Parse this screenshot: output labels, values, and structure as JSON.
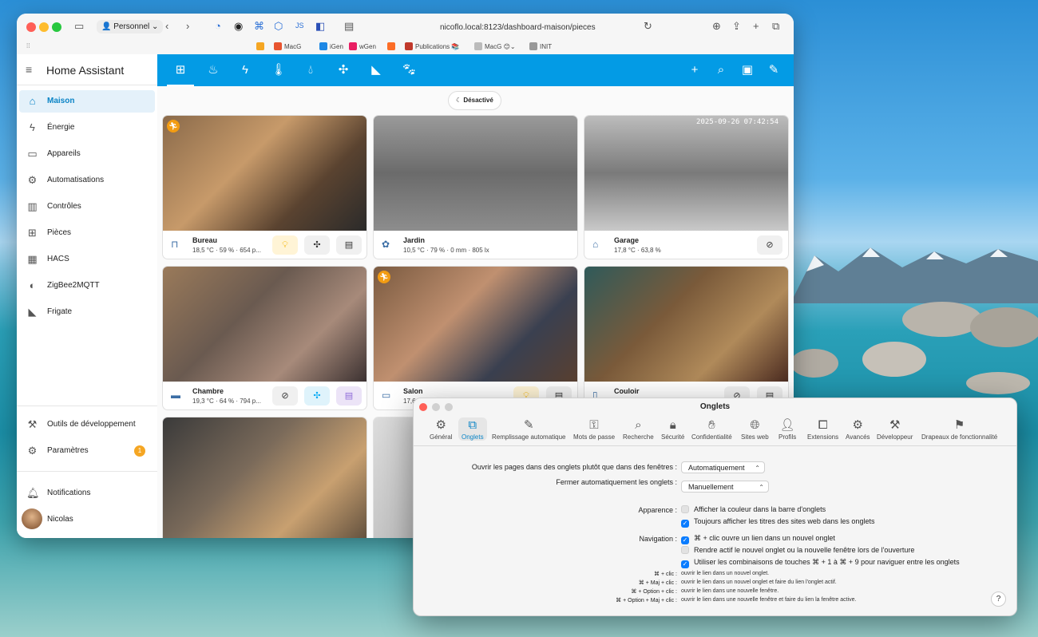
{
  "browser": {
    "profile": "Personnel",
    "url": "nicoflo.local:8123/dashboard-maison/pieces",
    "favorites": [
      "MacG",
      "iGen",
      "wGen",
      "Publications",
      "MacG",
      "INIT"
    ]
  },
  "sidebar": {
    "title": "Home Assistant",
    "items": [
      {
        "label": "Maison",
        "icon": "home-icon"
      },
      {
        "label": "Énergie",
        "icon": "lightning-icon"
      },
      {
        "label": "Appareils",
        "icon": "devices-icon"
      },
      {
        "label": "Automatisations",
        "icon": "robot-icon"
      },
      {
        "label": "Contrôles",
        "icon": "controls-icon"
      },
      {
        "label": "Pièces",
        "icon": "floorplan-icon"
      },
      {
        "label": "HACS",
        "icon": "hacs-icon"
      },
      {
        "label": "ZigBee2MQTT",
        "icon": "zigbee-icon"
      },
      {
        "label": "Frigate",
        "icon": "camera-icon"
      }
    ],
    "dev_tools": "Outils de développement",
    "settings": "Paramètres",
    "settings_badge": "1",
    "notifications": "Notifications",
    "user": "Nicolas"
  },
  "dashboard": {
    "chip": "Désactivé",
    "cameras": [
      {
        "name": "Bureau",
        "info": "18,5 °C · 59 % · 654 p..."
      },
      {
        "name": "Jardin",
        "info": "10,5 °C · 79 % · 0 mm · 805 lx"
      },
      {
        "name": "Garage",
        "info": "17,8 °C · 63,8 %",
        "timestamp": "2025-09-26 07:42:54"
      },
      {
        "name": "Chambre",
        "info": "19,3 °C · 64 % · 794 p..."
      },
      {
        "name": "Salon",
        "info": "17,6"
      },
      {
        "name": "Couloir",
        "info": ""
      }
    ]
  },
  "prefs": {
    "title": "Onglets",
    "tabs": [
      "Général",
      "Onglets",
      "Remplissage automatique",
      "Mots de passe",
      "Recherche",
      "Sécurité",
      "Confidentialité",
      "Sites web",
      "Profils",
      "Extensions",
      "Avancés",
      "Développeur",
      "Drapeaux de fonctionnalité"
    ],
    "open_pages_label": "Ouvrir les pages dans des onglets plutôt que dans des fenêtres :",
    "open_pages_value": "Automatiquement",
    "close_tabs_label": "Fermer automatiquement les onglets :",
    "close_tabs_value": "Manuellement",
    "appearance_label": "Apparence :",
    "appearance_opt1": "Afficher la couleur dans la barre d'onglets",
    "appearance_opt2": "Toujours afficher les titres des sites web dans les onglets",
    "navigation_label": "Navigation :",
    "nav_opt1": "⌘ + clic ouvre un lien dans un nouvel onglet",
    "nav_opt2": "Rendre actif le nouvel onglet ou la nouvelle fenêtre lors de l'ouverture",
    "nav_opt3": "Utiliser les combinaisons de touches ⌘ + 1 à ⌘ + 9 pour naviguer entre les onglets",
    "shortcuts": [
      {
        "k": "⌘ + clic :",
        "v": "ouvrir le lien dans un nouvel onglet."
      },
      {
        "k": "⌘ + Maj + clic :",
        "v": "ouvrir le lien dans un nouvel onglet et faire du lien l'onglet actif."
      },
      {
        "k": "⌘ + Option + clic :",
        "v": "ouvrir le lien dans une nouvelle fenêtre."
      },
      {
        "k": "⌘ + Option + Maj + clic :",
        "v": "ouvrir le lien dans une nouvelle fenêtre et faire du lien la fenêtre active."
      }
    ],
    "help": "?"
  }
}
